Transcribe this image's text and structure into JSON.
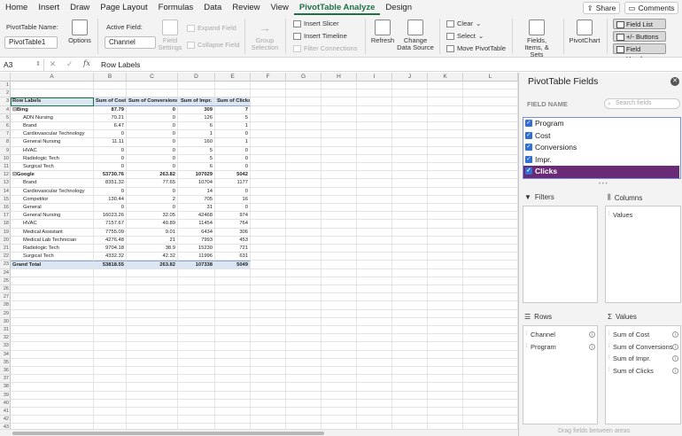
{
  "tabs": [
    "Home",
    "Insert",
    "Draw",
    "Page Layout",
    "Formulas",
    "Data",
    "Review",
    "View",
    "PivotTable Analyze",
    "Design"
  ],
  "active_tab": "PivotTable Analyze",
  "top_buttons": {
    "share": "Share",
    "comments": "Comments"
  },
  "ribbon": {
    "pivot_name_label": "PivotTable Name:",
    "pivot_name_value": "PivotTable1",
    "options": "Options",
    "active_field_label": "Active Field:",
    "active_field_value": "Channel",
    "field_settings": "Field Settings",
    "expand_field": "Expand Field",
    "collapse_field": "Collapse Field",
    "group_selection": "Group Selection",
    "insert_slicer": "Insert Slicer",
    "insert_timeline": "Insert Timeline",
    "filter_connections": "Filter Connections",
    "refresh": "Refresh",
    "change_data_source": "Change Data Source",
    "clear": "Clear",
    "select": "Select",
    "move_pivottable": "Move PivotTable",
    "fields_items_sets": "Fields, Items, & Sets",
    "pivotchart": "PivotChart",
    "field_list": "Field List",
    "buttons": "+/- Buttons",
    "field_headers": "Field Headers"
  },
  "formula_bar": {
    "cell_ref": "A3",
    "fx": "fx",
    "value": "Row Labels"
  },
  "columns": [
    "A",
    "B",
    "C",
    "D",
    "E",
    "F",
    "G",
    "H",
    "I",
    "J",
    "K",
    "L"
  ],
  "pivot": {
    "headers": [
      "Row Labels",
      "Sum of Cost",
      "Sum of Conversions",
      "Sum of Impr.",
      "Sum of Clicks"
    ],
    "rows": [
      {
        "type": "sub",
        "label": "Bing",
        "values": [
          "87.79",
          "0",
          "309",
          "7"
        ]
      },
      {
        "type": "item",
        "label": "ADN Nursing",
        "values": [
          "70.21",
          "0",
          "126",
          "5"
        ]
      },
      {
        "type": "item",
        "label": "Brand",
        "values": [
          "6.47",
          "0",
          "6",
          "1"
        ]
      },
      {
        "type": "item",
        "label": "Cardiovascular Technology",
        "values": [
          "0",
          "0",
          "1",
          "0"
        ]
      },
      {
        "type": "item",
        "label": "General Nursing",
        "values": [
          "11.11",
          "0",
          "160",
          "1"
        ]
      },
      {
        "type": "item",
        "label": "HVAC",
        "values": [
          "0",
          "0",
          "5",
          "0"
        ]
      },
      {
        "type": "item",
        "label": "Radiologic Tech",
        "values": [
          "0",
          "0",
          "5",
          "0"
        ]
      },
      {
        "type": "item",
        "label": "Surgical Tech",
        "values": [
          "0",
          "0",
          "6",
          "0"
        ]
      },
      {
        "type": "sub",
        "label": "Google",
        "values": [
          "53730.76",
          "263.82",
          "107029",
          "5042"
        ]
      },
      {
        "type": "item",
        "label": "Brand",
        "values": [
          "8351.32",
          "77.65",
          "10704",
          "1177"
        ]
      },
      {
        "type": "item",
        "label": "Cardiovascular Technology",
        "values": [
          "0",
          "0",
          "14",
          "0"
        ]
      },
      {
        "type": "item",
        "label": "Competitor",
        "values": [
          "130.44",
          "2",
          "705",
          "16"
        ]
      },
      {
        "type": "item",
        "label": "General",
        "values": [
          "0",
          "0",
          "31",
          "0"
        ]
      },
      {
        "type": "item",
        "label": "General Nursing",
        "values": [
          "16023.26",
          "32.05",
          "42468",
          "974"
        ]
      },
      {
        "type": "item",
        "label": "HVAC",
        "values": [
          "7157.67",
          "40.89",
          "11454",
          "764"
        ]
      },
      {
        "type": "item",
        "label": "Medical Assistant",
        "values": [
          "7755.09",
          "9.01",
          "6434",
          "306"
        ]
      },
      {
        "type": "item",
        "label": "Medical Lab Technician",
        "values": [
          "4276.48",
          "21",
          "7993",
          "453"
        ]
      },
      {
        "type": "item",
        "label": "Radiologic Tech",
        "values": [
          "9704.18",
          "38.9",
          "15230",
          "721"
        ]
      },
      {
        "type": "item",
        "label": "Surgical Tech",
        "values": [
          "4332.32",
          "42.32",
          "11996",
          "631"
        ]
      },
      {
        "type": "grand",
        "label": "Grand Total",
        "values": [
          "53818.55",
          "263.82",
          "107338",
          "5049"
        ]
      }
    ]
  },
  "row_numbers": [
    "1",
    "2",
    "3",
    "4",
    "5",
    "6",
    "7",
    "8",
    "9",
    "10",
    "11",
    "12",
    "13",
    "14",
    "15",
    "16",
    "17",
    "18",
    "19",
    "20",
    "21",
    "22",
    "23",
    "24",
    "25",
    "26",
    "27",
    "28",
    "29",
    "30",
    "31",
    "32",
    "33",
    "34",
    "35",
    "36",
    "37",
    "38",
    "39",
    "40",
    "41",
    "42",
    "43"
  ],
  "pane": {
    "title": "PivotTable Fields",
    "field_name_label": "FIELD NAME",
    "search_placeholder": "Search fields",
    "fields": [
      {
        "name": "Program",
        "checked": true
      },
      {
        "name": "Cost",
        "checked": true
      },
      {
        "name": "Conversions",
        "checked": true
      },
      {
        "name": "Impr.",
        "checked": true
      },
      {
        "name": "Clicks",
        "checked": true
      }
    ],
    "selected_field": "Clicks",
    "filters_label": "Filters",
    "columns_label": "Columns",
    "columns_items": [
      "Values"
    ],
    "rows_label": "Rows",
    "rows_items": [
      "Channel",
      "Program"
    ],
    "values_label": "Values",
    "values_items": [
      "Sum of Cost",
      "Sum of Conversions",
      "Sum of Impr.",
      "Sum of Clicks"
    ],
    "drag_hint": "Drag fields between areas"
  },
  "colors": {
    "accent": "#1e7145",
    "selected_field": "#6b2a75",
    "checkbox": "#2f6fd6",
    "pivot_header": "#dce6f2"
  }
}
